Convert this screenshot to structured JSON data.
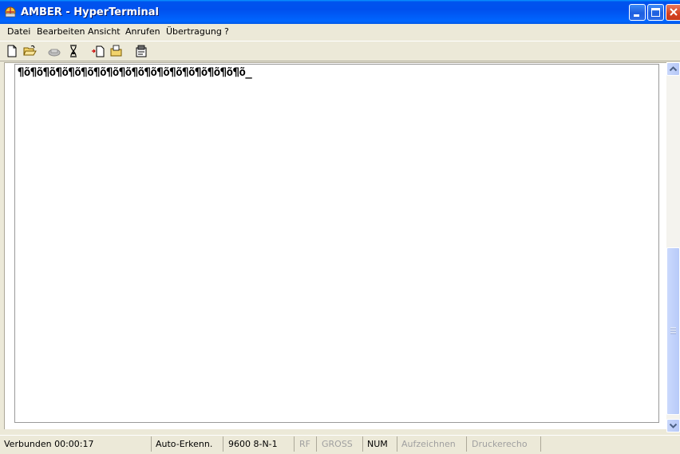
{
  "window": {
    "title": "AMBER - HyperTerminal"
  },
  "menu": [
    "Datei",
    "Bearbeiten",
    "Ansicht",
    "Anrufen",
    "Übertragung",
    "?"
  ],
  "toolbar": {
    "icons": [
      "new-file-icon",
      "open-folder-icon",
      "call-icon",
      "disconnect-icon",
      "send-icon",
      "receive-icon",
      "properties-icon"
    ]
  },
  "terminal": {
    "text": "¶õ¶õ¶õ¶õ¶õ¶õ¶õ¶õ¶õ¶õ¶õ¶õ¶õ¶õ¶õ¶õ¶õ¶õ_"
  },
  "status": {
    "connected": "Verbunden 00:00:17",
    "detect": "Auto-Erkenn.",
    "port": "9600 8-N-1",
    "rf": "RF",
    "caps": "GROSS",
    "num": "NUM",
    "capture": "Aufzeichnen",
    "echo": "Druckerecho"
  },
  "colors": {
    "titlebar": "#0054E3",
    "chrome": "#ECE9D8",
    "close": "#D5401F"
  }
}
